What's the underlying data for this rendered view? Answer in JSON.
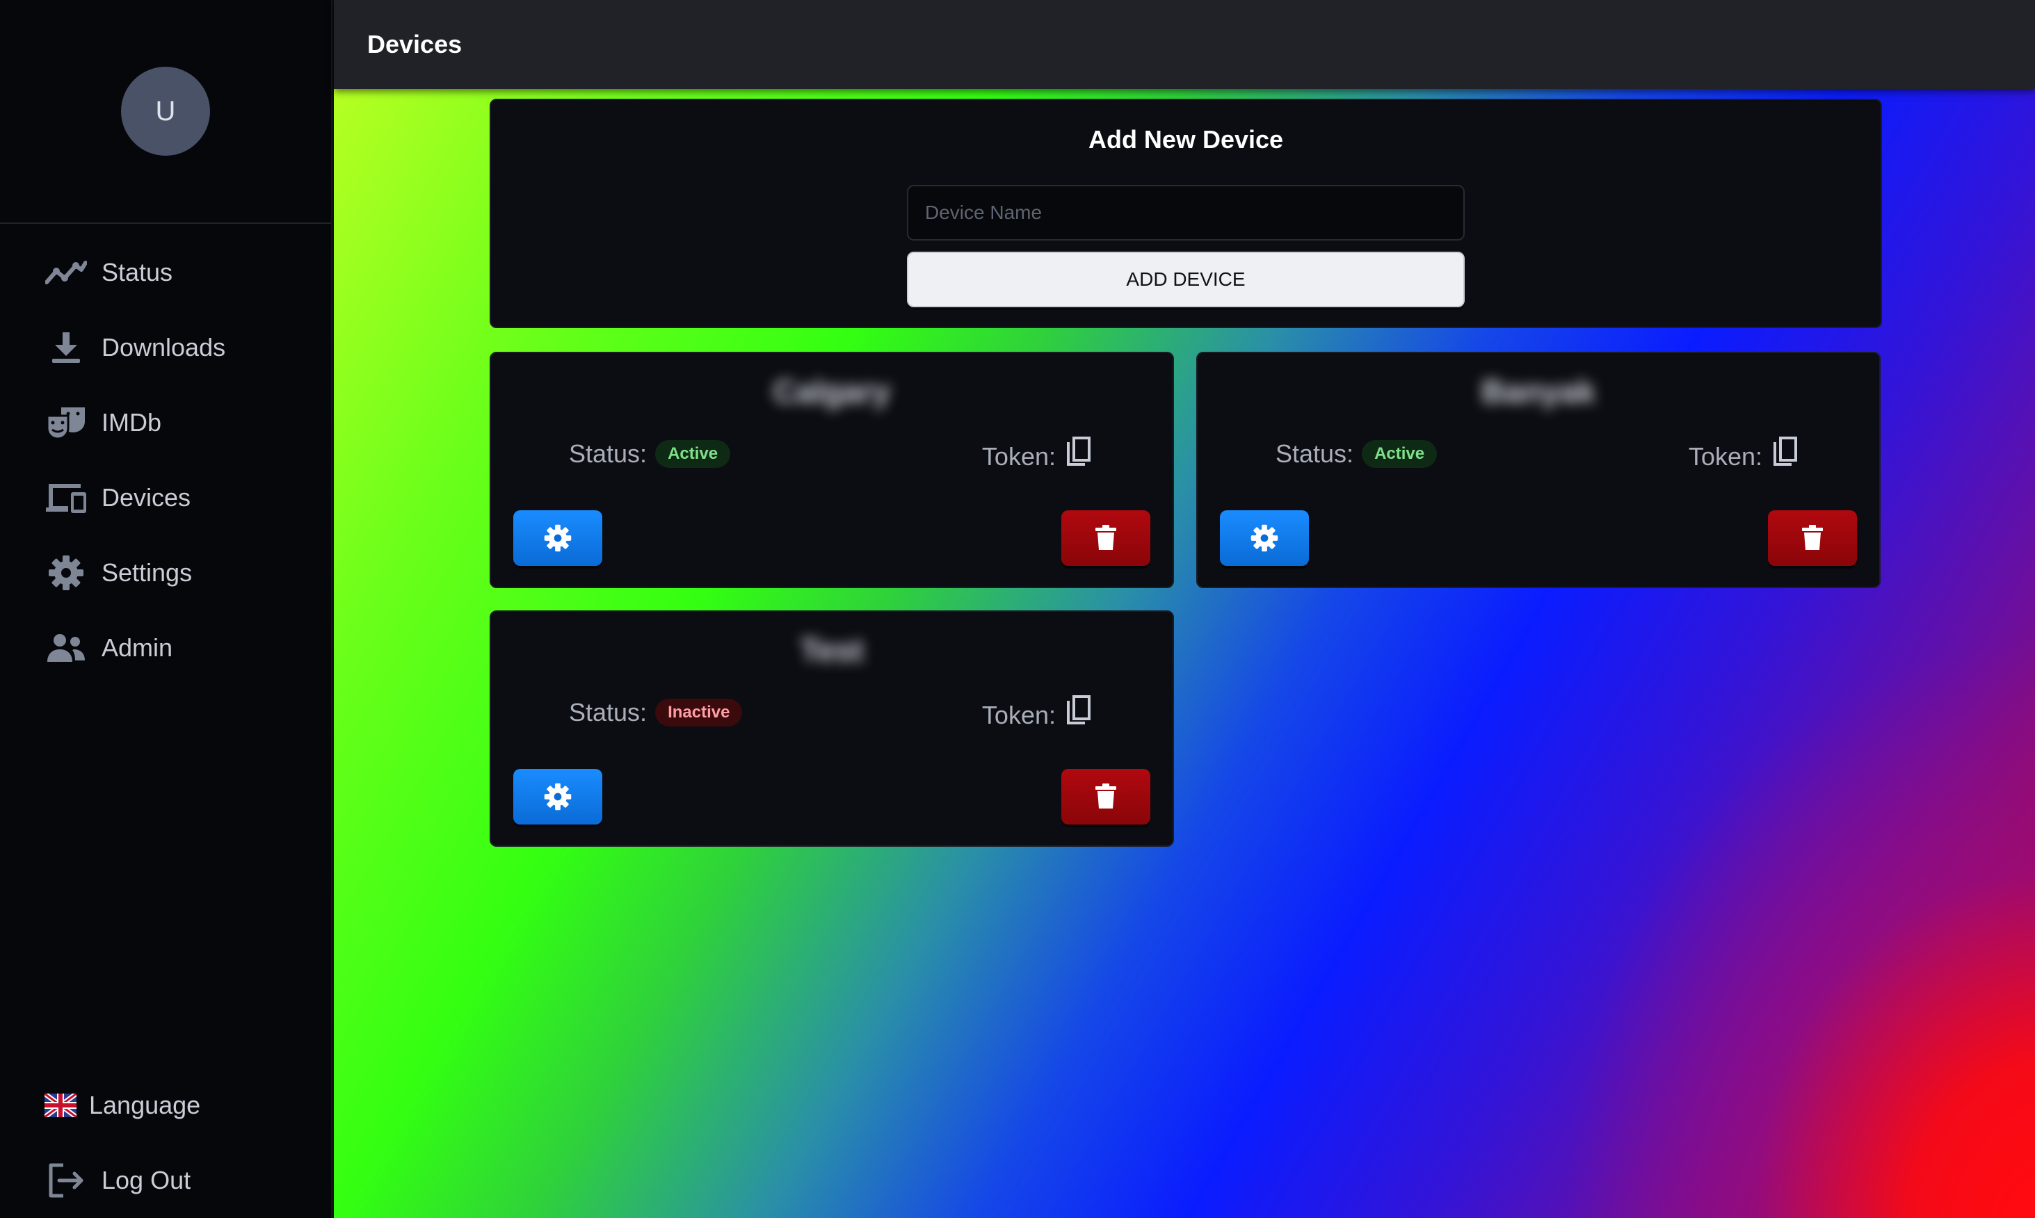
{
  "app": {
    "page_title": "Devices"
  },
  "user": {
    "avatar_initial": "U"
  },
  "sidebar": {
    "items": [
      {
        "label": "Status",
        "icon": "chart-line-icon"
      },
      {
        "label": "Downloads",
        "icon": "download-icon"
      },
      {
        "label": "IMDb",
        "icon": "theater-masks-icon"
      },
      {
        "label": "Devices",
        "icon": "devices-icon"
      },
      {
        "label": "Settings",
        "icon": "gear-icon"
      },
      {
        "label": "Admin",
        "icon": "users-icon"
      }
    ],
    "bottom": [
      {
        "label": "Language",
        "icon": "uk-flag-icon"
      },
      {
        "label": "Log Out",
        "icon": "logout-icon"
      }
    ]
  },
  "add_device": {
    "title": "Add New Device",
    "input_placeholder": "Device Name",
    "input_value": "",
    "button_label": "ADD DEVICE"
  },
  "devices": [
    {
      "name": "Calgary",
      "status_label": "Status:",
      "status": "Active",
      "token_label": "Token:"
    },
    {
      "name": "Banyak",
      "status_label": "Status:",
      "status": "Active",
      "token_label": "Token:"
    },
    {
      "name": "Test",
      "status_label": "Status:",
      "status": "Inactive",
      "token_label": "Token:"
    }
  ],
  "colors": {
    "sidebar_bg": "#06070a",
    "topbar_bg": "#202227",
    "card_bg": "#0b0d12",
    "settings_button": "#0a6bd6",
    "delete_button": "#8a0509",
    "badge_active": "#7fe08b",
    "badge_inactive": "#ff9ea4"
  }
}
